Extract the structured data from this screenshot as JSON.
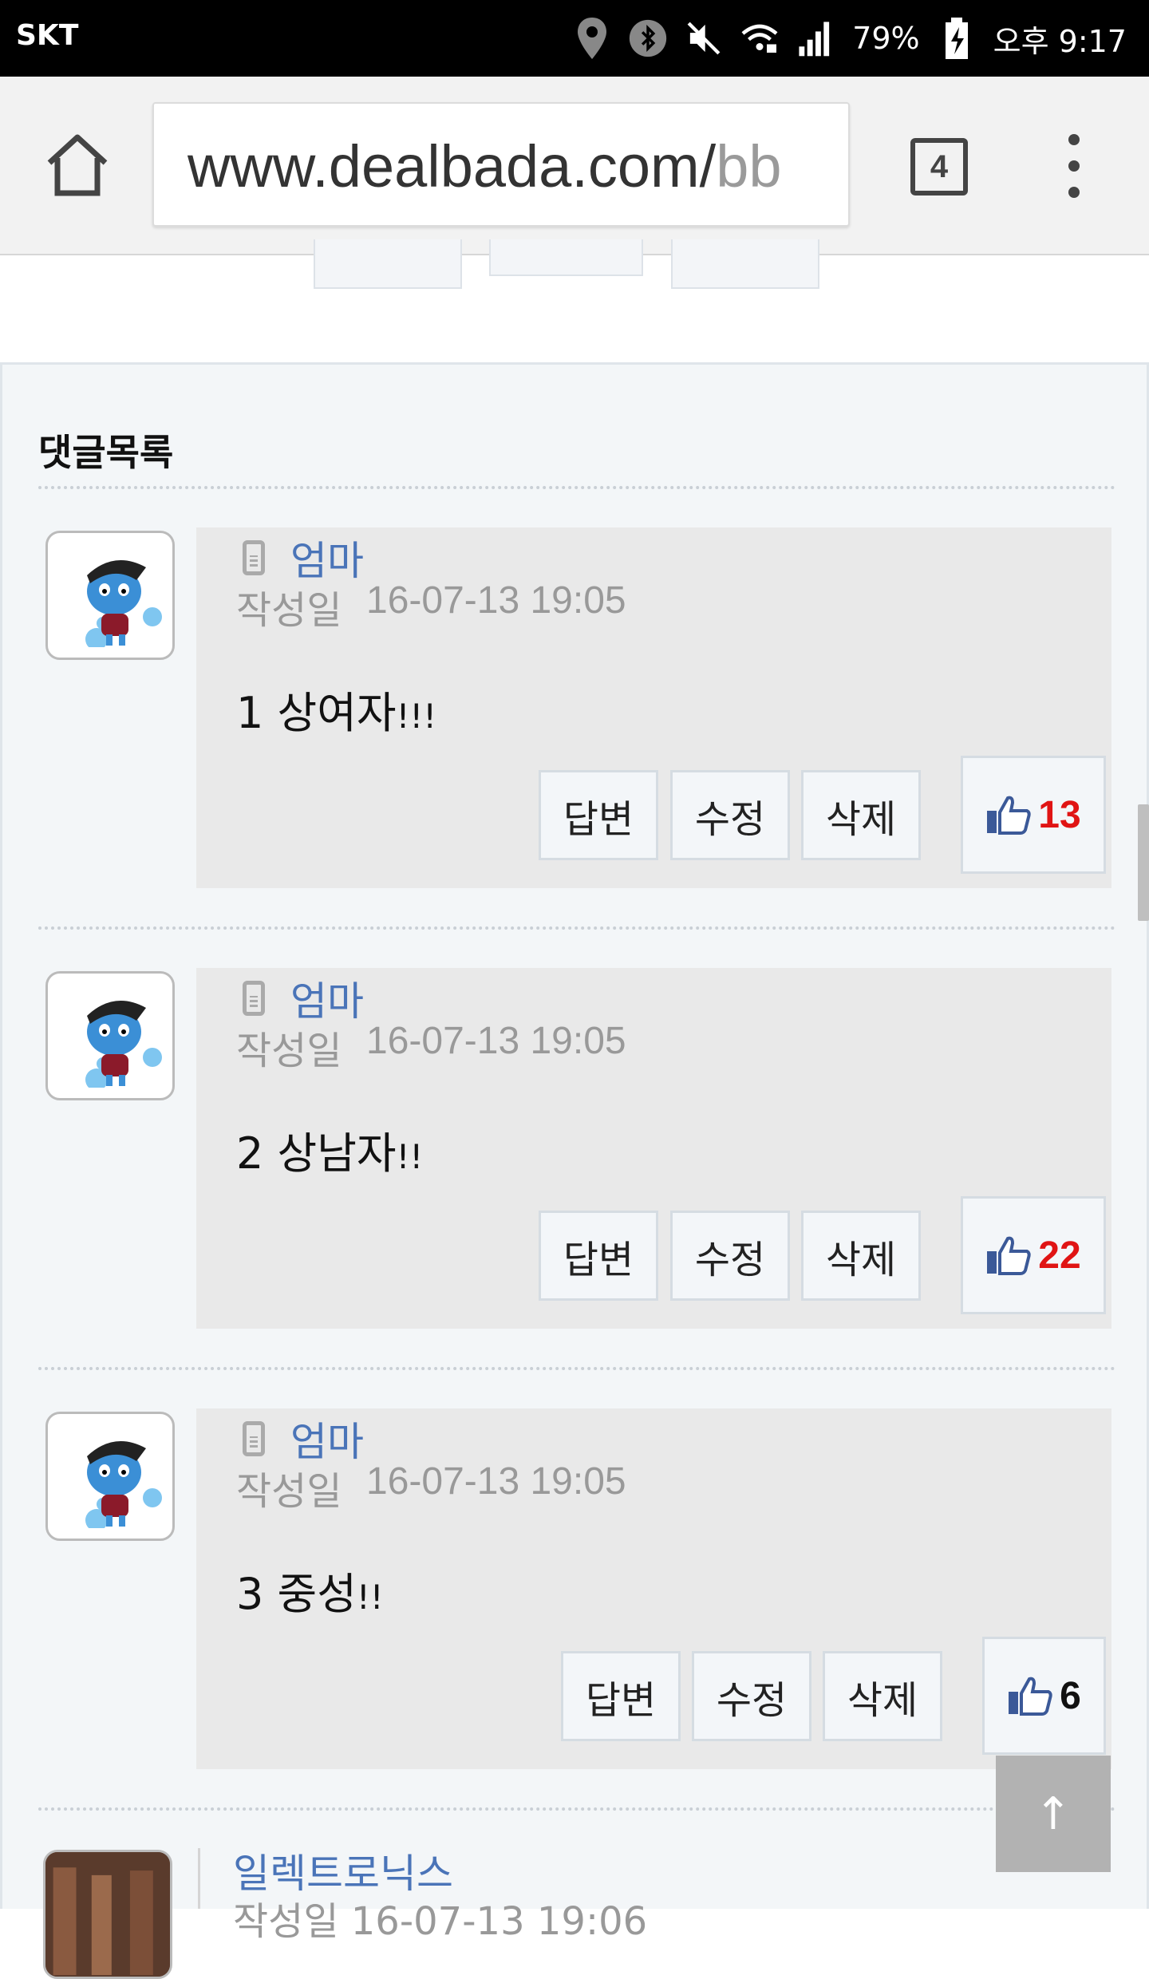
{
  "status_bar": {
    "carrier": "SKT",
    "battery": "79%",
    "time": "오후 9:17"
  },
  "browser": {
    "url_main": "www.dealbada.com/",
    "url_rest": "bb",
    "tab_count": "4"
  },
  "comments_section": {
    "title": "댓글목록",
    "comments": [
      {
        "author": "엄마",
        "date_label": "작성일",
        "date": "16-07-13 19:05",
        "text": "1 상여자",
        "text_suffix": "!!!",
        "reply_label": "답변",
        "edit_label": "수정",
        "delete_label": "삭제",
        "likes": "13",
        "like_color": "#e01414"
      },
      {
        "author": "엄마",
        "date_label": "작성일",
        "date": "16-07-13 19:05",
        "text": "2 상남자",
        "text_suffix": "!!",
        "reply_label": "답변",
        "edit_label": "수정",
        "delete_label": "삭제",
        "likes": "22",
        "like_color": "#e01414"
      },
      {
        "author": "엄마",
        "date_label": "작성일",
        "date": "16-07-13 19:05",
        "text": "3 중성",
        "text_suffix": "!!",
        "reply_label": "답변",
        "edit_label": "수정",
        "delete_label": "삭제",
        "likes": "6",
        "like_color": "#111111"
      }
    ],
    "partial_comment": {
      "author": "일렉트로닉스",
      "date": "작성일  16-07-13 19:06"
    }
  },
  "scroll_top_label": "↑",
  "icons": [
    "location-icon",
    "bluetooth-icon",
    "mute-icon",
    "wifi-icon",
    "signal-icon",
    "battery-icon",
    "home-icon",
    "tabs-icon",
    "menu-icon",
    "mobile-icon",
    "thumbs-up-icon"
  ]
}
